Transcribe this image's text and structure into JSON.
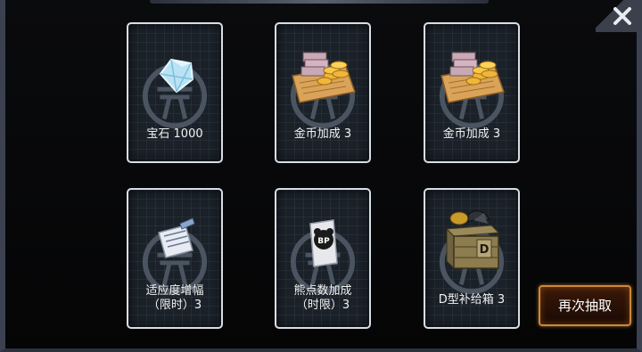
{
  "rewards": [
    {
      "name_lines": [
        "宝石 1000"
      ],
      "icon": "diamond-icon"
    },
    {
      "name_lines": [
        "金币加成 3"
      ],
      "icon": "gold-bonus-icon"
    },
    {
      "name_lines": [
        "金币加成 3"
      ],
      "icon": "gold-bonus-icon"
    },
    {
      "name_lines": [
        "适应度增幅",
        "（限时）3"
      ],
      "icon": "document-icon"
    },
    {
      "name_lines": [
        "熊点数加成",
        "（时限）3"
      ],
      "icon": "bp-card-icon"
    },
    {
      "name_lines": [
        "D型补给箱 3"
      ],
      "icon": "supply-crate-icon"
    }
  ],
  "redraw_button": {
    "label": "再次抽取"
  },
  "colors": {
    "accent": "#c98a3a",
    "card_border": "#d9dde4"
  }
}
